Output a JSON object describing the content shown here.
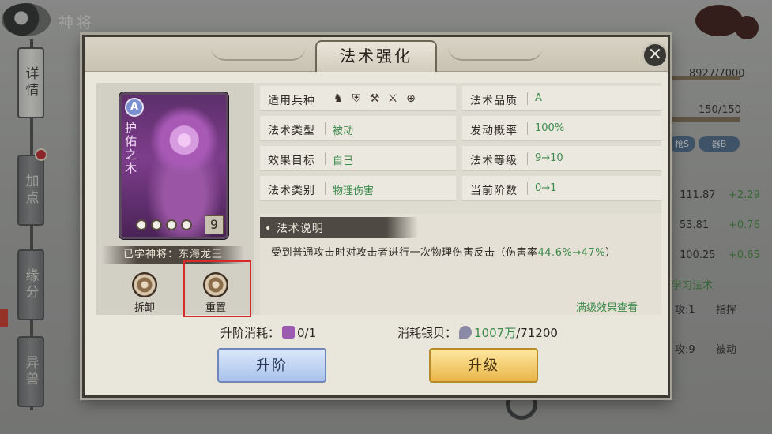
{
  "background": {
    "title": "神将",
    "side_tabs": [
      "详情",
      "加点",
      "缘分",
      "异兽"
    ],
    "right_stats": {
      "exp": "8927/7000",
      "hp": "150/150",
      "pill_left": "枪S",
      "pill_right": "器B",
      "stat1_value": "111.87",
      "stat1_delta": "+2.29",
      "stat2_value": "53.81",
      "stat2_delta": "+0.76",
      "stat3_value": "100.25",
      "stat3_delta": "+0.65",
      "link": "学习法术",
      "row1_label": "攻:1",
      "row1_value": "指挥",
      "row2_label": "攻:9",
      "row2_value": "被动"
    }
  },
  "modal": {
    "title": "法术强化",
    "close_icon": "close-icon",
    "card": {
      "grade": "A",
      "name": "护佑之木",
      "level": "9",
      "stars": 4
    },
    "learned_by": "已学神将：东海龙王",
    "actions": [
      {
        "label": "拆卸",
        "icon": "swirl-icon"
      },
      {
        "label": "重置",
        "icon": "swirl-icon"
      }
    ],
    "info": {
      "troop_label": "适用兵种",
      "troop_icons": [
        "horse-icon",
        "shield-icon",
        "pickaxe-icon",
        "crossed-swords-icon",
        "target-icon"
      ],
      "type_label": "法术类型",
      "type_value": "被动",
      "target_label": "效果目标",
      "target_value": "自己",
      "category_label": "法术类别",
      "category_value": "物理伤害",
      "quality_label": "法术品质",
      "quality_value": "A",
      "chance_label": "发动概率",
      "chance_value": "100%",
      "level_label": "法术等级",
      "level_value": "9→10",
      "stage_label": "当前阶数",
      "stage_value": "0→1"
    },
    "description": {
      "tag": "• 法术说明",
      "text_main": "受到普通攻击时对攻击者进行一次物理伤害反击（伤害率",
      "text_highlight": "44.6%→47%",
      "text_end": "）",
      "max_link": "满级效果查看"
    },
    "costs": {
      "rank_label": "升阶消耗：",
      "rank_value": "0/1",
      "silver_label": "消耗银贝：",
      "silver_have": "1007万",
      "silver_need": "/71200"
    },
    "buttons": {
      "rank_up": "升阶",
      "level_up": "升级"
    },
    "colors": {
      "accent_green": "#3d8a4b",
      "highlight_red": "#d92a2a",
      "button_blue": "#a9c2ec",
      "button_gold": "#e8b649"
    }
  }
}
